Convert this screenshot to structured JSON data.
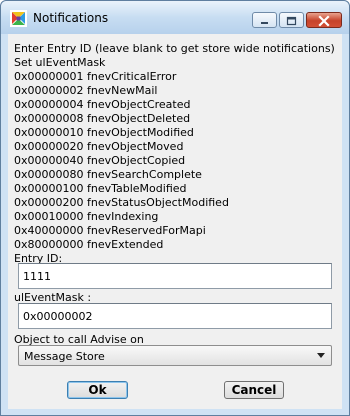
{
  "window": {
    "title": "Notifications"
  },
  "intro": {
    "line1": "Enter Entry ID (leave blank to get store wide notifications)",
    "line2": "Set ulEventMask"
  },
  "events": [
    "0x00000001 fnevCriticalError",
    "0x00000002 fnevNewMail",
    "0x00000004 fnevObjectCreated",
    "0x00000008 fnevObjectDeleted",
    "0x00000010 fnevObjectModified",
    "0x00000020 fnevObjectMoved",
    "0x00000040 fnevObjectCopied",
    "0x00000080 fnevSearchComplete",
    "0x00000100 fnevTableModified",
    "0x00000200 fnevStatusObjectModified",
    "0x00010000 fnevIndexing",
    "0x40000000 fnevReservedForMapi",
    "0x80000000 fnevExtended"
  ],
  "entry_id": {
    "label": "Entry ID:",
    "value": "1111"
  },
  "event_mask": {
    "label": "ulEventMask :",
    "value": "0x00000002"
  },
  "advise_object": {
    "label": "Object to call Advise on",
    "value": "Message Store"
  },
  "buttons": {
    "ok": "Ok",
    "cancel": "Cancel"
  }
}
